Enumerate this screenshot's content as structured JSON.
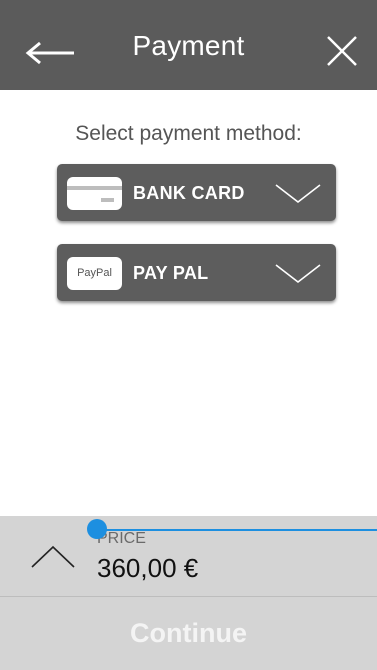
{
  "header": {
    "title": "Payment",
    "back_icon": "arrow-left-icon",
    "close_icon": "close-icon"
  },
  "prompt": "Select payment method:",
  "methods": [
    {
      "label": "BANK CARD",
      "icon": "credit-card-icon"
    },
    {
      "label": "PAY PAL",
      "badge_text": "PayPal",
      "icon": "paypal-icon"
    }
  ],
  "price": {
    "caption": "PRICE",
    "value": "360,00 €"
  },
  "continue_label": "Continue",
  "colors": {
    "header": "#5b5b5b",
    "method_bg": "#5d5d5d",
    "accent": "#1d8fe0",
    "footer": "#d4d4d4"
  }
}
